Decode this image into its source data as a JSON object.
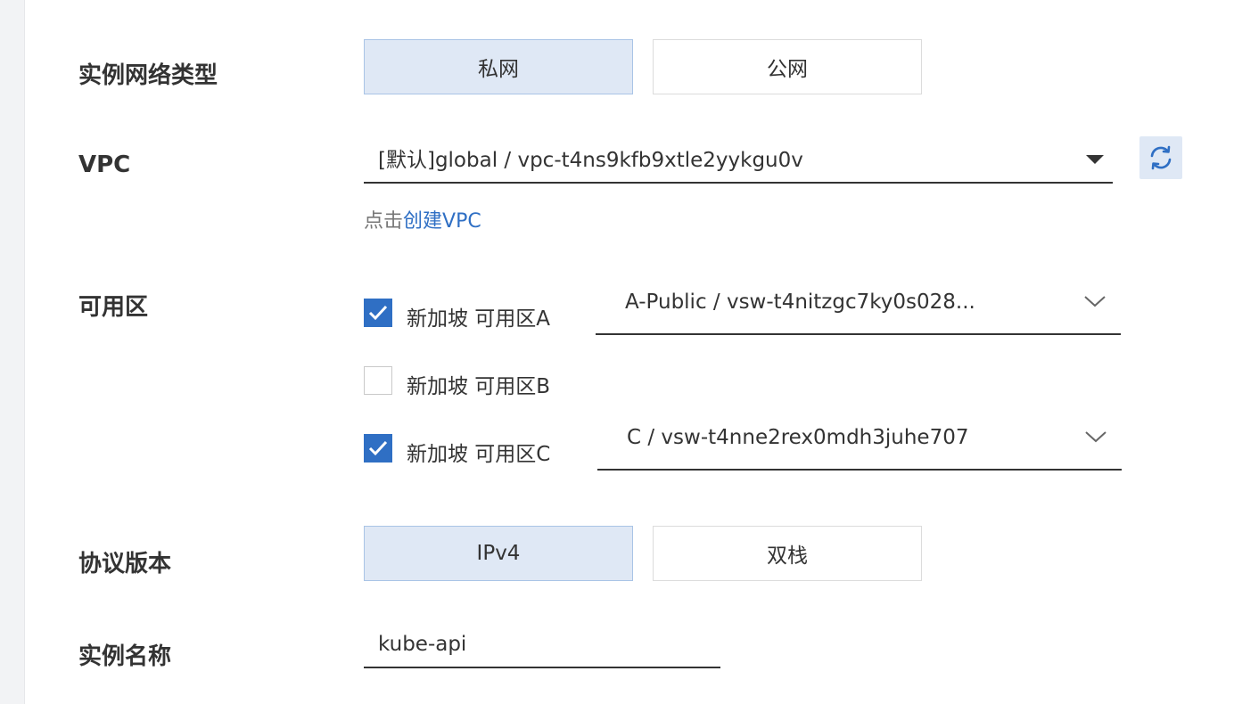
{
  "network_type": {
    "label": "实例网络类型",
    "options": [
      "私网",
      "公网"
    ],
    "selected": "私网"
  },
  "vpc": {
    "label": "VPC",
    "value": "[默认]global / vpc-t4ns9kfb9xtle2yykgu0v",
    "hint_prefix": "点击",
    "hint_link": "创建VPC",
    "refresh_icon": "refresh-icon"
  },
  "zones": {
    "label": "可用区",
    "items": [
      {
        "name": "新加坡 可用区A",
        "checked": true,
        "vswitch": "A-Public / vsw-t4nitzgc7ky0s028..."
      },
      {
        "name": "新加坡 可用区B",
        "checked": false,
        "vswitch": ""
      },
      {
        "name": "新加坡 可用区C",
        "checked": true,
        "vswitch": "C / vsw-t4nne2rex0mdh3juhe707"
      }
    ]
  },
  "protocol": {
    "label": "协议版本",
    "options": [
      "IPv4",
      "双栈"
    ],
    "selected": "IPv4"
  },
  "instance_name": {
    "label": "实例名称",
    "value": "kube-api"
  },
  "colors": {
    "accent": "#2f6fc4",
    "selected_bg": "#dfe8f5",
    "selected_border": "#a9c4e6"
  }
}
